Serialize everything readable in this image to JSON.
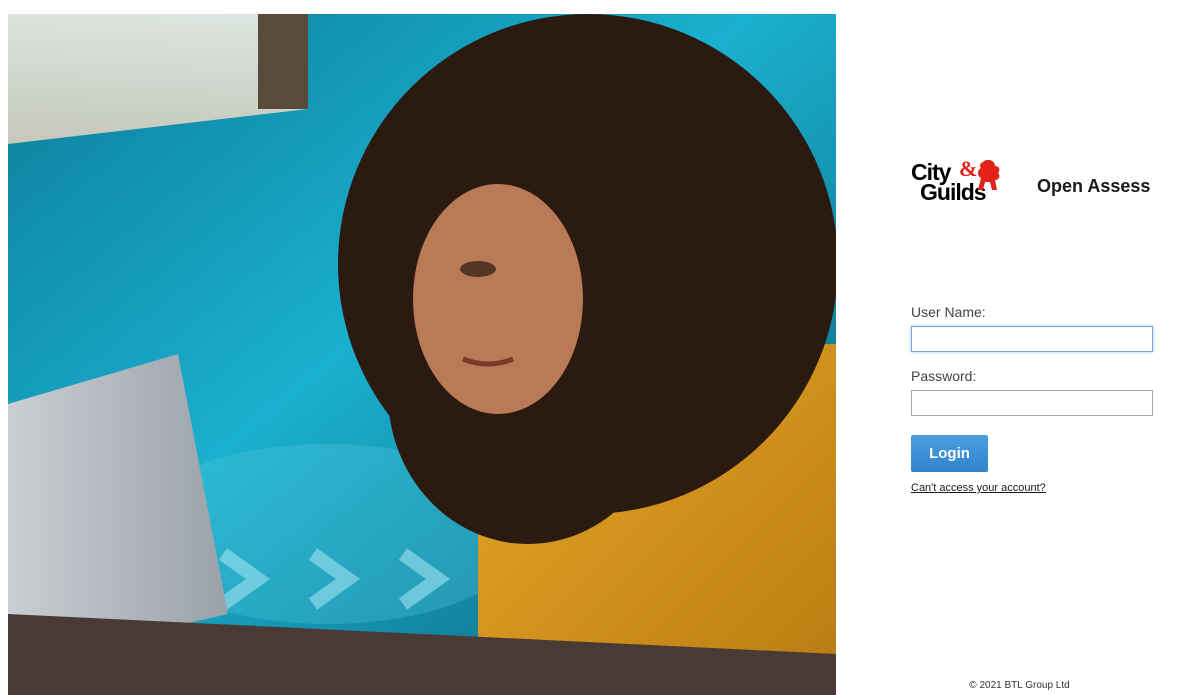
{
  "brand": {
    "logo_line1": "City",
    "logo_amp": "&",
    "logo_line2": "Guilds",
    "product": "Open Assess",
    "accent_color": "#e2231a"
  },
  "hero": {
    "image_subject": "woman-at-laptop-photo"
  },
  "form": {
    "username_label": "User Name:",
    "username_value": "",
    "password_label": "Password:",
    "password_value": "",
    "login_label": "Login",
    "help_link": "Can't access your account?",
    "button_color": "#3b8fd6"
  },
  "footer": {
    "copyright": "© 2021 BTL Group Ltd"
  }
}
